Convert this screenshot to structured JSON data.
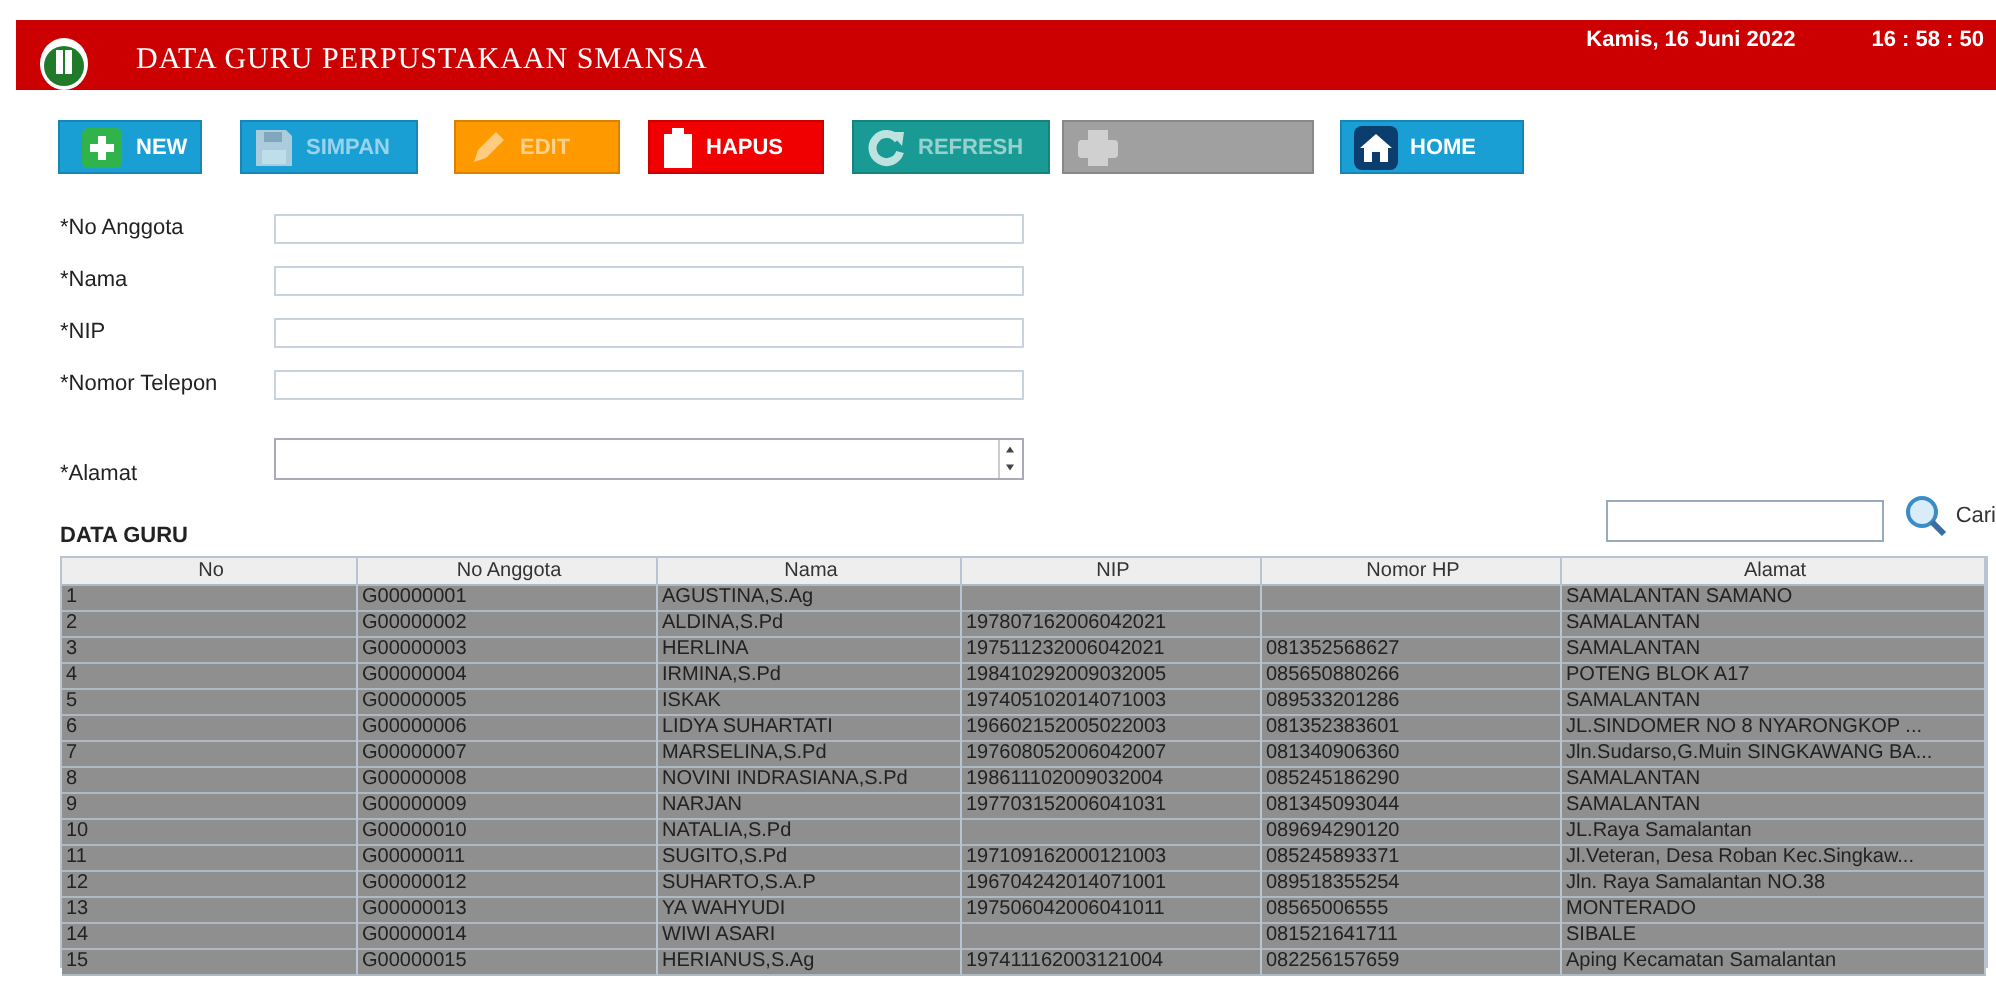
{
  "header": {
    "title": "DATA GURU PERPUSTAKAAN SMANSA",
    "date": "Kamis, 16 Juni 2022",
    "time": "16 : 58 : 50"
  },
  "toolbar": [
    {
      "kind": "new",
      "label": "NEW",
      "disabled": false
    },
    {
      "kind": "save",
      "label": "SIMPAN",
      "disabled": true
    },
    {
      "kind": "edit",
      "label": "EDIT",
      "disabled": true
    },
    {
      "kind": "delete",
      "label": "HAPUS",
      "disabled": false
    },
    {
      "kind": "refresh",
      "label": "REFRESH",
      "disabled": true
    },
    {
      "kind": "print",
      "disabled": true
    },
    {
      "kind": "home",
      "label": "HOME",
      "disabled": false
    }
  ],
  "form": [
    {
      "label": "*No Anggota",
      "kind": "text"
    },
    {
      "label": "*Nama",
      "kind": "text"
    },
    {
      "label": "*NIP",
      "kind": "text"
    },
    {
      "label": "*Nomor Telepon",
      "kind": "text"
    },
    {
      "label": "*Alamat",
      "kind": "textarea"
    }
  ],
  "table": {
    "title": "DATA GURU",
    "search": {
      "button": "Cari"
    },
    "columns": [
      "No",
      "No Anggota",
      "Nama",
      "NIP",
      "Nomor HP",
      "Alamat"
    ],
    "rows": [
      [
        "1",
        "G00000001",
        "AGUSTINA,S.Ag",
        null,
        null,
        "SAMALANTAN SAMANO"
      ],
      [
        "2",
        "G00000002",
        "ALDINA,S.Pd",
        "197807162006042021",
        null,
        "SAMALANTAN"
      ],
      [
        "3",
        "G00000003",
        "HERLINA",
        "197511232006042021",
        "081352568627",
        "SAMALANTAN"
      ],
      [
        "4",
        "G00000004",
        "IRMINA,S.Pd",
        "198410292009032005",
        "085650880266",
        "POTENG BLOK A17"
      ],
      [
        "5",
        "G00000005",
        "ISKAK",
        "197405102014071003",
        "089533201286",
        "SAMALANTAN"
      ],
      [
        "6",
        "G00000006",
        "LIDYA SUHARTATI",
        "196602152005022003",
        "081352383601",
        "JL.SINDOMER NO 8 NYARONGKOP ..."
      ],
      [
        "7",
        "G00000007",
        "MARSELINA,S.Pd",
        "197608052006042007",
        "081340906360",
        "Jln.Sudarso,G.Muin SINGKAWANG BA..."
      ],
      [
        "8",
        "G00000008",
        "NOVINI INDRASIANA,S.Pd",
        "198611102009032004",
        "085245186290",
        "SAMALANTAN"
      ],
      [
        "9",
        "G00000009",
        "NARJAN",
        "197703152006041031",
        "081345093044",
        "SAMALANTAN"
      ],
      [
        "10",
        "G00000010",
        "NATALIA,S.Pd",
        null,
        "089694290120",
        "JL.Raya Samalantan"
      ],
      [
        "11",
        "G00000011",
        "SUGITO,S.Pd",
        "197109162000121003",
        "085245893371",
        "Jl.Veteran, Desa Roban Kec.Singkaw..."
      ],
      [
        "12",
        "G00000012",
        "SUHARTO,S.A.P",
        "196704242014071001",
        "089518355254",
        "Jln. Raya Samalantan NO.38"
      ],
      [
        "13",
        "G00000013",
        "YA WAHYUDI",
        "197506042006041011",
        "08565006555",
        "MONTERADO"
      ],
      [
        "14",
        "G00000014",
        "WIWI ASARI",
        null,
        "081521641711",
        "SIBALE"
      ],
      [
        "15",
        "G00000015",
        "HERIANUS,S.Ag",
        "197411162003121004",
        "082256157659",
        "Aping Kecamatan Samalantan"
      ]
    ]
  }
}
